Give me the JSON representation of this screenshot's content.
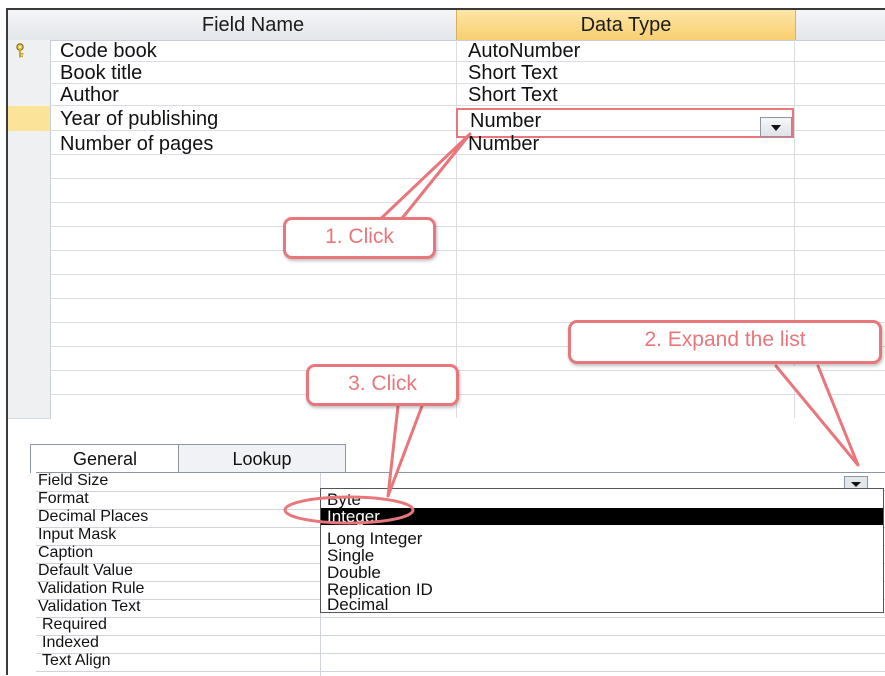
{
  "grid": {
    "headers": {
      "field_name": "Field Name",
      "data_type": "Data Type"
    },
    "rows": [
      {
        "field": "Code book",
        "type": "AutoNumber",
        "primary_key": true
      },
      {
        "field": "Book title",
        "type": "Short Text"
      },
      {
        "field": "Author",
        "type": "Short Text"
      },
      {
        "field": "Year of publishing",
        "type": "Number",
        "current": true
      },
      {
        "field": "Number of pages",
        "type": "Number"
      }
    ]
  },
  "tabs": {
    "general": "General",
    "lookup": "Lookup"
  },
  "properties": [
    "Field Size",
    "Format",
    "Decimal Places",
    "Input Mask",
    "Caption",
    "Default Value",
    "Validation Rule",
    "Validation Text",
    "Required",
    "Indexed",
    "Text Align"
  ],
  "field_size_options": [
    "Byte",
    "Integer",
    "Long Integer",
    "Single",
    "Double",
    "Replication ID",
    "Decimal"
  ],
  "field_size_highlighted": "Integer",
  "callouts": {
    "step1": "1. Click",
    "step2": "2. Expand the list",
    "step3": "3. Click"
  },
  "colors": {
    "annotation": "#e9767b",
    "header_highlight": "#f8cf6f",
    "current_row": "#fbe39a"
  }
}
